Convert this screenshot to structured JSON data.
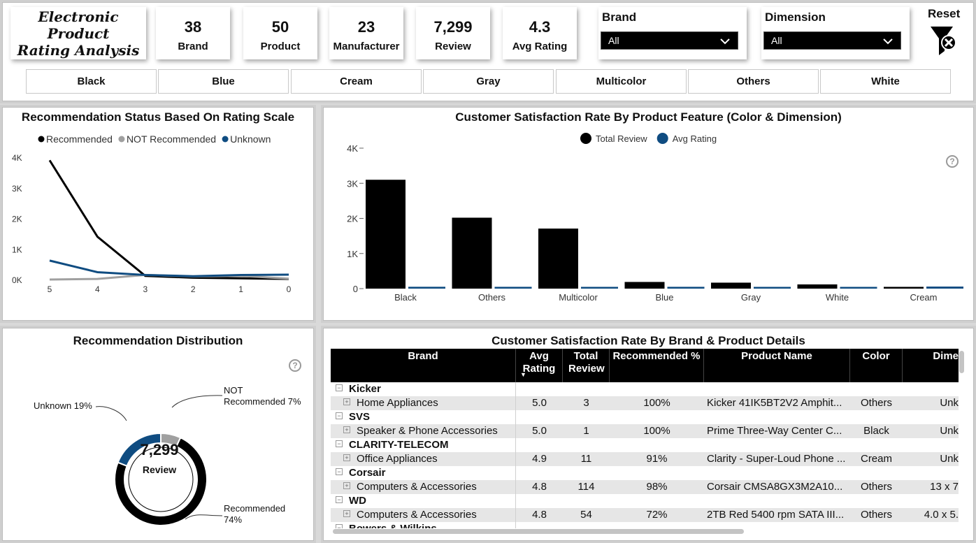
{
  "header": {
    "title_line1": "Electronic Product",
    "title_line2": "Rating Analysis"
  },
  "kpis": [
    {
      "value": "38",
      "label": "Brand"
    },
    {
      "value": "50",
      "label": "Product"
    },
    {
      "value": "23",
      "label": "Manufacturer"
    },
    {
      "value": "7,299",
      "label": "Review"
    },
    {
      "value": "4.3",
      "label": "Avg Rating"
    }
  ],
  "slicers": {
    "brand": {
      "label": "Brand",
      "value": "All"
    },
    "dimension": {
      "label": "Dimension",
      "value": "All"
    }
  },
  "reset_label": "Reset",
  "color_buttons": [
    "Black",
    "Blue",
    "Cream",
    "Gray",
    "Multicolor",
    "Others",
    "White"
  ],
  "colors": {
    "black": "#000000",
    "gray": "#a0a0a0",
    "blue": "#0f4c81"
  },
  "line_chart": {
    "title": "Recommendation Status Based On Rating Scale",
    "legend": [
      "Recommended",
      "NOT Recommended",
      "Unknown"
    ],
    "y_ticks": [
      "4K",
      "3K",
      "2K",
      "1K",
      "0K"
    ],
    "x_ticks": [
      "5",
      "4",
      "3",
      "2",
      "1",
      "0"
    ]
  },
  "bar_chart": {
    "title": "Customer Satisfaction Rate By Product Feature (Color & Dimension)",
    "legend": [
      "Total Review",
      "Avg Rating"
    ],
    "y_ticks": [
      "4K",
      "3K",
      "2K",
      "1K",
      "0"
    ],
    "help": "?"
  },
  "donut": {
    "title": "Recommendation Distribution",
    "center_value": "7,299",
    "center_label": "Review",
    "label_unknown": "Unknown 19%",
    "label_not_line1": "NOT",
    "label_not_line2": "Recommended 7%",
    "label_rec_line1": "Recommended",
    "label_rec_line2": "74%",
    "help": "?"
  },
  "chart_data": [
    {
      "type": "line",
      "title": "Recommendation Status Based On Rating Scale",
      "x": [
        5,
        4,
        3,
        2,
        1,
        0
      ],
      "series": [
        {
          "name": "Recommended",
          "values": [
            3900,
            1400,
            120,
            60,
            40,
            20
          ]
        },
        {
          "name": "NOT Recommended",
          "values": [
            0,
            20,
            150,
            100,
            120,
            30
          ]
        },
        {
          "name": "Unknown",
          "values": [
            620,
            240,
            150,
            110,
            150,
            160
          ]
        }
      ],
      "ylim": [
        0,
        4000
      ],
      "legend_position": "top"
    },
    {
      "type": "bar",
      "title": "Customer Satisfaction Rate By Product Feature (Color & Dimension)",
      "categories": [
        "Black",
        "Others",
        "Multicolor",
        "Blue",
        "Gray",
        "White",
        "Cream"
      ],
      "series": [
        {
          "name": "Total Review",
          "values": [
            3100,
            2020,
            1710,
            190,
            170,
            120,
            50
          ]
        },
        {
          "name": "Avg Rating",
          "values": [
            4.4,
            4.3,
            4.2,
            4.3,
            4.2,
            4.1,
            4.9
          ]
        }
      ],
      "ylim": [
        0,
        4000
      ],
      "legend_position": "top"
    },
    {
      "type": "pie",
      "title": "Recommendation Distribution",
      "categories": [
        "Recommended",
        "Unknown",
        "NOT Recommended"
      ],
      "values": [
        74,
        19,
        7
      ]
    }
  ],
  "table": {
    "title": "Customer Satisfaction Rate By Brand & Product Details",
    "headers": [
      "Brand",
      "Avg Rating",
      "Total Review",
      "Recommended %",
      "Product Name",
      "Color",
      "Dime"
    ],
    "groups": [
      {
        "brand": "Kicker",
        "category": "Home Appliances",
        "avg": "5.0",
        "total": "3",
        "rec": "100%",
        "product": "Kicker 41IK5BT2V2 Amphit...",
        "color": "Others",
        "dim": "Unk"
      },
      {
        "brand": "SVS",
        "category": "Speaker & Phone Accessories",
        "avg": "5.0",
        "total": "1",
        "rec": "100%",
        "product": "Prime Three-Way Center C...",
        "color": "Black",
        "dim": "Unk"
      },
      {
        "brand": "CLARITY-TELECOM",
        "category": "Office Appliances",
        "avg": "4.9",
        "total": "11",
        "rec": "91%",
        "product": "Clarity - Super-Loud Phone ...",
        "color": "Cream",
        "dim": "Unk"
      },
      {
        "brand": "Corsair",
        "category": "Computers & Accessories",
        "avg": "4.8",
        "total": "114",
        "rec": "98%",
        "product": "Corsair CMSA8GX3M2A10...",
        "color": "Others",
        "dim": "13 x 7"
      },
      {
        "brand": "WD",
        "category": "Computers & Accessories",
        "avg": "4.8",
        "total": "54",
        "rec": "72%",
        "product": "2TB Red 5400 rpm SATA III...",
        "color": "Others",
        "dim": "4.0 x 5."
      },
      {
        "brand": "Bowers & Wilkins",
        "category": "",
        "avg": "",
        "total": "",
        "rec": "",
        "product": "",
        "color": "",
        "dim": ""
      }
    ]
  }
}
